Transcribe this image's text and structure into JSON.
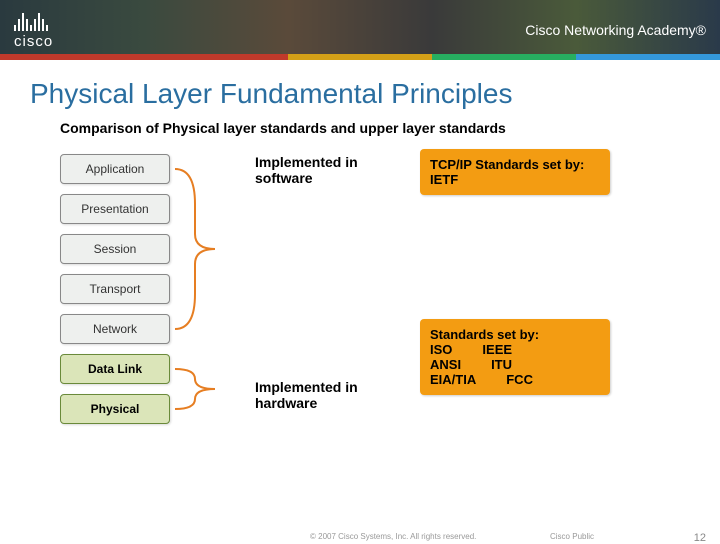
{
  "banner": {
    "logo_text": "cisco",
    "academy_text": "Cisco Networking Academy®"
  },
  "title": "Physical Layer Fundamental Principles",
  "subtitle": "Comparison of Physical layer standards and upper layer standards",
  "layers": {
    "application": "Application",
    "presentation": "Presentation",
    "session": "Session",
    "transport": "Transport",
    "network": "Network",
    "datalink": "Data Link",
    "physical": "Physical"
  },
  "mid": {
    "software": "Implemented in software",
    "hardware": "Implemented in hardware"
  },
  "right": {
    "tcpip_title": "TCP/IP Standards set by:",
    "tcpip_body": "IETF",
    "stds_title": "Standards set by:",
    "stds": {
      "iso": "ISO",
      "ieee": "IEEE",
      "ansi": "ANSI",
      "itu": "ITU",
      "eiatia": "EIA/TIA",
      "fcc": "FCC"
    }
  },
  "footer": {
    "copyright": "© 2007 Cisco Systems, Inc. All rights reserved.",
    "public": "Cisco Public",
    "page": "12"
  },
  "chart_data": {
    "type": "table",
    "title": "Comparison of Physical layer standards and upper layer standards",
    "osi_layers": [
      "Application",
      "Presentation",
      "Session",
      "Transport",
      "Network",
      "Data Link",
      "Physical"
    ],
    "groups": [
      {
        "layers": [
          "Application",
          "Presentation",
          "Session",
          "Transport",
          "Network"
        ],
        "implemented_in": "software",
        "standards_set_by": [
          "IETF"
        ],
        "standard_family": "TCP/IP"
      },
      {
        "layers": [
          "Data Link",
          "Physical"
        ],
        "implemented_in": "hardware",
        "standards_set_by": [
          "ISO",
          "IEEE",
          "ANSI",
          "ITU",
          "EIA/TIA",
          "FCC"
        ]
      }
    ]
  }
}
